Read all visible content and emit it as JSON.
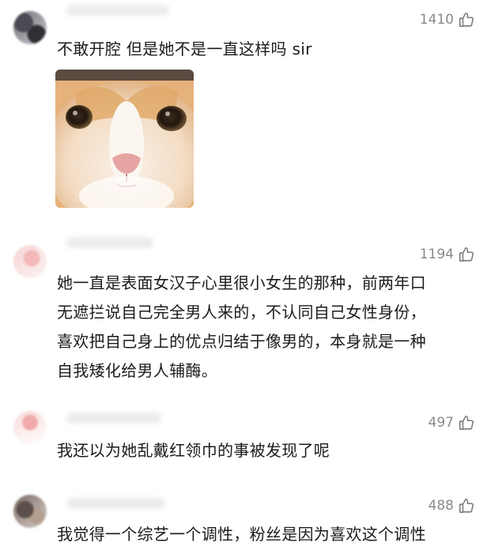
{
  "comments": [
    {
      "likes": "1410",
      "text": "不敢开腔 但是她不是一直这样吗 sir",
      "image": "cat-photo"
    },
    {
      "likes": "1194",
      "lines": [
        "她一直是表面女汉子心里很小女生的那种，前两年口",
        "无遮拦说自己完全男人来的，不认同自己女性身份，",
        "喜欢把自己身上的优点归结于像男的，本身就是一种",
        "自我矮化给男人辅酶。"
      ]
    },
    {
      "likes": "497",
      "text": "我还以为她乱戴红领巾的事被发现了呢"
    },
    {
      "likes": "488",
      "text": "我觉得一个综艺一个调性，粉丝是因为喜欢这个调性"
    }
  ],
  "icons": {
    "like": "thumbs-up-icon"
  },
  "colors": {
    "muted": "#8a8a8a",
    "text": "#1b1b1b"
  }
}
